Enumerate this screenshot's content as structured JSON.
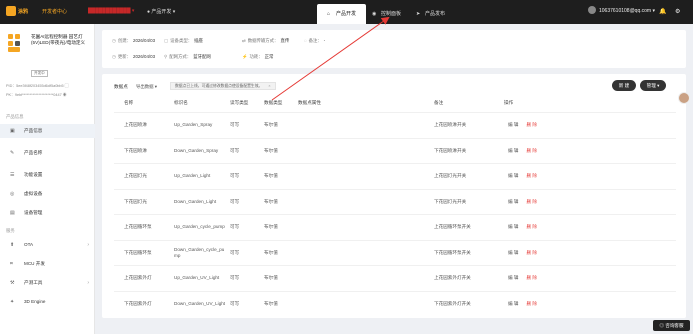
{
  "topbar": {
    "brand": "涂鸦",
    "dev_center": "开发者中心",
    "redacted": "████████████ ▾",
    "product_dev_menu": "● 产品开发 ▾",
    "tabs": [
      {
        "label": "产品开发",
        "icon": "⌂"
      },
      {
        "label": "控制面板",
        "icon": "◉"
      },
      {
        "label": "产品发布",
        "icon": "➤"
      }
    ],
    "account": "10637610108@qq.com ▾",
    "bell_icon": "🔔",
    "settings_icon": "⚙"
  },
  "sidebar": {
    "product_name": "花園AI远程控制器 园艺灯(5V)LED(带夜光)/电动定义",
    "proto_badge": "开发中",
    "pid": "PID：5ee3f48f203455d6df5a0bb5 ▢",
    "pkey": "PK：9ebf*********************0447 ◉",
    "section_product": "产品信息",
    "items_product": [
      {
        "label": "产品信息",
        "icon": "▣",
        "active": true
      },
      {
        "label": "产品名称",
        "icon": "✎",
        "active": false
      },
      {
        "label": "功能设置",
        "icon": "☰",
        "active": false
      },
      {
        "label": "虚拟设备",
        "icon": "◎",
        "active": false
      },
      {
        "label": "设备管理",
        "icon": "▤",
        "active": false
      }
    ],
    "section_service": "服务",
    "items_service": [
      {
        "label": "OTA",
        "icon": "⬆",
        "chev": "›"
      },
      {
        "label": "MCU 开发",
        "icon": "⌗",
        "chev": ""
      },
      {
        "label": "产测工具",
        "icon": "⚒",
        "chev": "›"
      },
      {
        "label": "3D Engine",
        "icon": "✦",
        "chev": ""
      }
    ]
  },
  "info": {
    "created_label": "创建：",
    "created": "2026/04/03",
    "type_label": "设备类型：",
    "type": "插座",
    "protocol_label": "数据传输方式：",
    "protocol": "直传",
    "notes_label": "备注：",
    "notes": "-",
    "updated_label": "更新：",
    "updated": "2026/04/03",
    "network_label": "配网方式：",
    "network": "蓝牙配网",
    "power_label": "功耗：",
    "power": "正常"
  },
  "list": {
    "title": "数据点",
    "export": "导出数据 ▾",
    "tip": "数据点已上线，可通过修改数据点使设备配置生效。",
    "tip_close": "×",
    "btn_new": "新 建",
    "btn_manage": "管理 ▾",
    "columns": [
      "名称",
      "标识名",
      "读写类型",
      "数据类型",
      "数据点属性",
      "备注",
      "操作"
    ],
    "rows": [
      {
        "name": "上花园喷淋",
        "id": "Up_Garden_Spray",
        "rw": "可写",
        "type": "布尔值",
        "attr": "",
        "note": "上花园喷淋开关"
      },
      {
        "name": "下花园喷淋",
        "id": "Down_Garden_Spray",
        "rw": "可写",
        "type": "布尔值",
        "attr": "",
        "note": "下花园喷淋开关"
      },
      {
        "name": "上花园灯光",
        "id": "Up_Garden_Light",
        "rw": "可写",
        "type": "布尔值",
        "attr": "",
        "note": "上花园灯光开关"
      },
      {
        "name": "下花园灯光",
        "id": "Down_Garden_Light",
        "rw": "可写",
        "type": "布尔值",
        "attr": "",
        "note": "下花园灯光开关"
      },
      {
        "name": "上花园循环泵",
        "id": "Up_Garden_cycle_pump",
        "rw": "可写",
        "type": "布尔值",
        "attr": "",
        "note": "上花园循环泵开关"
      },
      {
        "name": "下花园循环泵",
        "id": "Down_Garden_cycle_pump",
        "rw": "可写",
        "type": "布尔值",
        "attr": "",
        "note": "下花园循环泵开关"
      },
      {
        "name": "上花园紫外灯",
        "id": "Up_Garden_UV_Light",
        "rw": "可写",
        "type": "布尔值",
        "attr": "",
        "note": "上花园紫外灯开关"
      },
      {
        "name": "下花园紫外灯",
        "id": "Down_Garden_UV_Light",
        "rw": "可写",
        "type": "布尔值",
        "attr": "",
        "note": "下花园紫外灯开关"
      }
    ],
    "edit": "编 辑",
    "delete": "删 除"
  },
  "help": "◎ 咨询客服",
  "colors": {
    "brand": "#f5a623",
    "danger": "#e53935",
    "annotation": "#e53935"
  }
}
